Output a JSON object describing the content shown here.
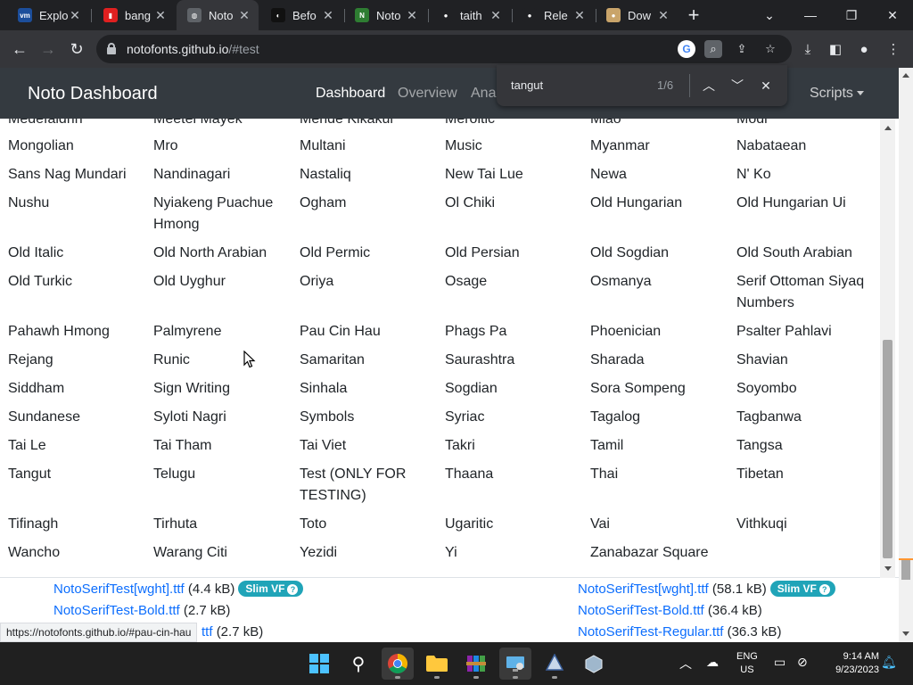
{
  "browser": {
    "tabs": [
      {
        "title": "Explo",
        "favicon": "vmware-icon",
        "color": "#1c4e9b",
        "glyph": "vm",
        "active": false
      },
      {
        "title": "bang",
        "favicon": "bookmark-red-icon",
        "color": "#e02020",
        "glyph": "▮",
        "active": false
      },
      {
        "title": "Noto",
        "favicon": "globe-icon",
        "color": "#5f6368",
        "glyph": "◍",
        "active": true
      },
      {
        "title": "Befo",
        "favicon": "dark-logo-icon",
        "color": "#111111",
        "glyph": "◐",
        "active": false
      },
      {
        "title": "Noto",
        "favicon": "noto-n-icon",
        "color": "#2e7d32",
        "glyph": "N",
        "active": false
      },
      {
        "title": "taith",
        "favicon": "github-icon",
        "color": "#202124",
        "glyph": "●",
        "active": false
      },
      {
        "title": "Rele",
        "favicon": "github-icon",
        "color": "#202124",
        "glyph": "●",
        "active": false
      },
      {
        "title": "Dow",
        "favicon": "cookie-icon",
        "color": "#c9a46a",
        "glyph": "●",
        "active": false
      }
    ],
    "url_host": "notofonts.github.io",
    "url_path": "/#test"
  },
  "navbar": {
    "brand": "Noto Dashboard",
    "links": [
      "Dashboard",
      "Overview",
      "Anal"
    ],
    "scripts_label": "Scripts"
  },
  "findbar": {
    "query": "tangut",
    "count": "1/6"
  },
  "scripts_grid": {
    "cut_row": [
      "Medefaidrin",
      "Meetei Mayek",
      "Mende Kikakui",
      "Meroitic",
      "Miao",
      "Modi"
    ],
    "rows": [
      [
        "Mongolian",
        "Mro",
        "Multani",
        "Music",
        "Myanmar",
        "Nabataean"
      ],
      [
        "Sans Nag Mundari",
        "Nandinagari",
        "Nastaliq",
        "New Tai Lue",
        "Newa",
        "N' Ko"
      ],
      [
        "Nushu",
        "Nyiakeng Puachue Hmong",
        "Ogham",
        "Ol Chiki",
        "Old Hungarian",
        "Old Hungarian Ui"
      ],
      [
        "Old Italic",
        "Old North Arabian",
        "Old Permic",
        "Old Persian",
        "Old Sogdian",
        "Old South Arabian"
      ],
      [
        "Old Turkic",
        "Old Uyghur",
        "Oriya",
        "Osage",
        "Osmanya",
        "Serif Ottoman Siyaq Numbers"
      ],
      [
        "Pahawh Hmong",
        "Palmyrene",
        "Pau Cin Hau",
        "Phags Pa",
        "Phoenician",
        "Psalter Pahlavi"
      ],
      [
        "Rejang",
        "Runic",
        "Samaritan",
        "Saurashtra",
        "Sharada",
        "Shavian"
      ],
      [
        "Siddham",
        "Sign Writing",
        "Sinhala",
        "Sogdian",
        "Sora Sompeng",
        "Soyombo"
      ],
      [
        "Sundanese",
        "Syloti Nagri",
        "Symbols",
        "Syriac",
        "Tagalog",
        "Tagbanwa"
      ],
      [
        "Tai Le",
        "Tai Tham",
        "Tai Viet",
        "Takri",
        "Tamil",
        "Tangsa"
      ],
      [
        "Tangut",
        "Telugu",
        "Test (ONLY FOR TESTING)",
        "Thaana",
        "Thai",
        "Tibetan"
      ],
      [
        "Tifinagh",
        "Tirhuta",
        "Toto",
        "Ugaritic",
        "Vai",
        "Vithkuqi"
      ],
      [
        "Wancho",
        "Warang Citi",
        "Yezidi",
        "Yi",
        "Zanabazar Square",
        ""
      ]
    ]
  },
  "files": {
    "left": [
      {
        "name": "NotoSerifTest[wght].ttf",
        "size": "(4.4 kB)",
        "badge": "Slim VF"
      },
      {
        "name": "NotoSerifTest-Bold.ttf",
        "size": "(2.7 kB)",
        "badge": ""
      },
      {
        "name": "ttf",
        "size": "(2.7 kB)",
        "badge": ""
      }
    ],
    "right": [
      {
        "name": "NotoSerifTest[wght].ttf",
        "size": "(58.1 kB)",
        "badge": "Slim VF"
      },
      {
        "name": "NotoSerifTest-Bold.ttf",
        "size": "(36.4 kB)",
        "badge": ""
      },
      {
        "name": "NotoSerifTest-Regular.ttf",
        "size": "(36.3 kB)",
        "badge": ""
      }
    ],
    "badge_help": "?"
  },
  "status_url": "https://notofonts.github.io/#pau-cin-hau",
  "taskbar": {
    "lang_line1": "ENG",
    "lang_line2": "US",
    "time": "9:14 AM",
    "date": "9/23/2023"
  }
}
